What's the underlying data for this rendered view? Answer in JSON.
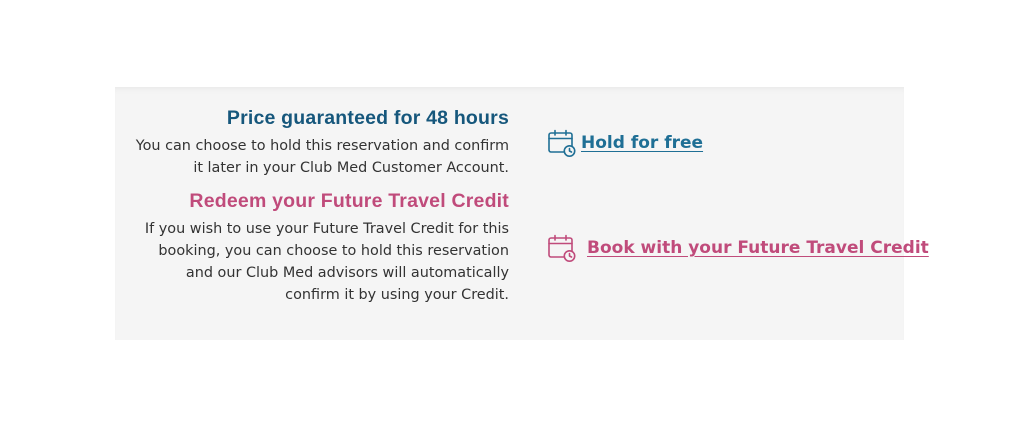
{
  "hold_section": {
    "title": "Price guaranteed for 48 hours",
    "description": "You can choose to hold this reservation and confirm it later in your Club Med Customer Account.",
    "action": {
      "label": "Hold for free",
      "icon": "calendar-clock-icon",
      "color": "#1f6f95"
    },
    "title_color": "#16577c"
  },
  "credit_section": {
    "title": "Redeem your Future Travel Credit",
    "description": "If you wish to use your Future Travel Credit for this booking, you can choose to hold this reservation and our Club Med advisors will automatically confirm it by using your Credit.",
    "action": {
      "label": "Book with your Future Travel Credit",
      "icon": "calendar-clock-icon",
      "color": "#c04b7b"
    },
    "title_color": "#c04b7b"
  }
}
